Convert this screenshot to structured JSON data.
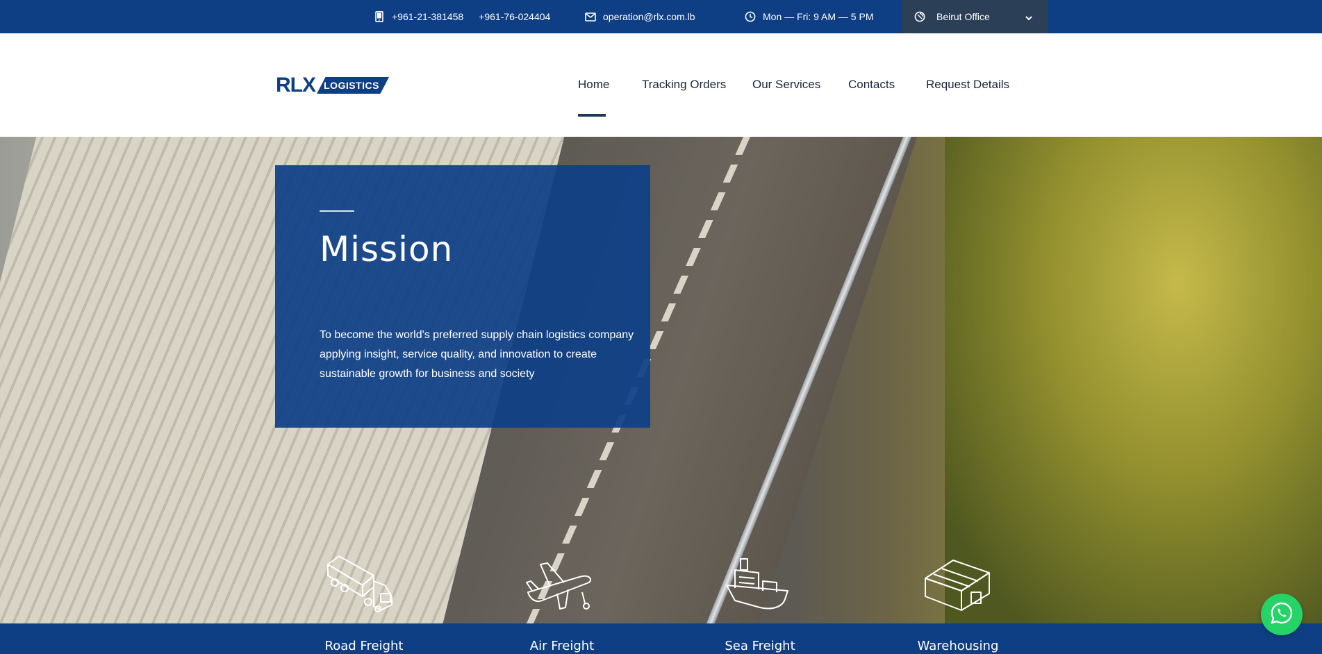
{
  "topbar": {
    "phone_1": "+961-21-381458",
    "phone_2": "+961-76-024404",
    "email": "operation@rlx.com.lb",
    "hours": "Mon — Fri: 9 AM — 5 PM",
    "office": "Beirut Office",
    "icons": [
      "phone-icon",
      "mail-icon",
      "clock-icon",
      "location-icon",
      "chevron-down-icon"
    ]
  },
  "header": {
    "logo": {
      "main": "RLX",
      "badge": "LOGISTICS"
    },
    "nav": [
      {
        "label": "Home",
        "active": true
      },
      {
        "label": "Tracking Orders"
      },
      {
        "label": "Our Services"
      },
      {
        "label": "Contacts"
      },
      {
        "label": "Request Details"
      }
    ]
  },
  "hero": {
    "title": "Mission",
    "text": "To become the world's preferred supply chain logistics company applying insight, service quality, and innovation to create sustainable growth for business and society"
  },
  "services": [
    {
      "label": "Road Freight",
      "icon": "truck-icon"
    },
    {
      "label": "Air Freight",
      "icon": "airplane-icon"
    },
    {
      "label": "Sea Freight",
      "icon": "ship-icon"
    },
    {
      "label": "Warehousing",
      "icon": "warehouse-icon"
    }
  ],
  "colors": {
    "brand": "#0e3f85",
    "office_bg": "#2b3f56",
    "whatsapp": "#25d366"
  }
}
